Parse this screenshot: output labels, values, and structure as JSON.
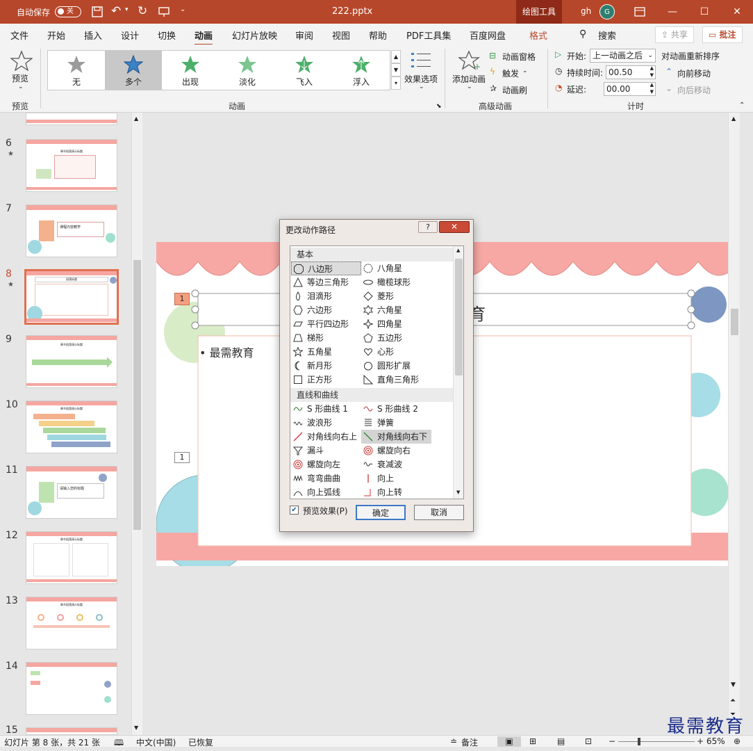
{
  "titlebar": {
    "autosave_label": "自动保存",
    "autosave_state": "关",
    "filename": "222.pptx",
    "context_tool": "绘图工具",
    "user_initials_text": "gh",
    "avatar_letter": "G"
  },
  "tabs": [
    "文件",
    "开始",
    "插入",
    "设计",
    "切换",
    "动画",
    "幻灯片放映",
    "审阅",
    "视图",
    "帮助",
    "PDF工具集",
    "百度网盘",
    "格式"
  ],
  "active_tab": "动画",
  "search_label": "搜索",
  "share_label": "共享",
  "comment_label": "批注",
  "ribbon": {
    "preview_label": "预览",
    "preview_group": "预览",
    "animation_group": "动画",
    "gallery": [
      {
        "label": "无",
        "color": "#9a9a9a"
      },
      {
        "label": "多个",
        "color": "#3b82c4"
      },
      {
        "label": "出现",
        "color": "#4caf6a"
      },
      {
        "label": "淡化",
        "color": "#7cc490"
      },
      {
        "label": "飞入",
        "color": "#4caf6a"
      },
      {
        "label": "浮入",
        "color": "#4caf6a"
      }
    ],
    "effect_options": "效果选项",
    "add_animation": "添加动画",
    "anim_pane": "动画窗格",
    "trigger": "触发",
    "anim_painter": "动画刷",
    "advanced_group": "高级动画",
    "start_label": "开始:",
    "start_value": "上一动画之后",
    "duration_label": "持续时间:",
    "duration_value": "00.50",
    "delay_label": "延迟:",
    "delay_value": "00.00",
    "reorder_label": "对动画重新排序",
    "move_earlier": "向前移动",
    "move_later": "向后移动",
    "timing_group": "计时"
  },
  "slides": [
    {
      "num": "6",
      "star": "★",
      "title": "章节段落演示标题"
    },
    {
      "num": "7",
      "star": "",
      "title": "课程内容教学"
    },
    {
      "num": "8",
      "star": "★",
      "title": "段落标题"
    },
    {
      "num": "9",
      "star": "",
      "title": "章节段落演示标题"
    },
    {
      "num": "10",
      "star": "",
      "title": "章节段落演示标题"
    },
    {
      "num": "11",
      "star": "",
      "title": "请输入您的标题"
    },
    {
      "num": "12",
      "star": "",
      "title": "章节段落演示标题"
    },
    {
      "num": "13",
      "star": "",
      "title": "章节段落演示标题"
    },
    {
      "num": "14",
      "star": "",
      "title": ""
    },
    {
      "num": "15",
      "star": "",
      "title": ""
    }
  ],
  "slide": {
    "anim_tag1": "1",
    "anim_tag2": "1",
    "title_fragment": "育",
    "bullet_text": "最需教育"
  },
  "dialog": {
    "title": "更改动作路径",
    "help": "?",
    "close": "✕",
    "section_basic": "基本",
    "basic_items": [
      [
        "八边形",
        "八角星"
      ],
      [
        "等边三角形",
        "橄榄球形"
      ],
      [
        "泪滴形",
        "菱形"
      ],
      [
        "六边形",
        "六角星"
      ],
      [
        "平行四边形",
        "四角星"
      ],
      [
        "梯形",
        "五边形"
      ],
      [
        "五角星",
        "心形"
      ],
      [
        "新月形",
        "圆形扩展"
      ],
      [
        "正方形",
        "直角三角形"
      ]
    ],
    "section_lines": "直线和曲线",
    "line_items": [
      [
        "S 形曲线 1",
        "S 形曲线 2"
      ],
      [
        "波浪形",
        "弹簧"
      ],
      [
        "对角线向右上",
        "对角线向右下"
      ],
      [
        "漏斗",
        "螺旋向右"
      ],
      [
        "螺旋向左",
        "衰减波"
      ],
      [
        "弯弯曲曲",
        "向上"
      ],
      [
        "向上弧线",
        "向上转"
      ]
    ],
    "preview_check": "预览效果(P)",
    "ok": "确定",
    "cancel": "取消"
  },
  "status": {
    "slide_info": "幻灯片 第 8 张，共 21 张",
    "language": "中文(中国)",
    "recovered": "已恢复",
    "notes": "备注",
    "zoom": "65%"
  },
  "watermark": "最需教育"
}
